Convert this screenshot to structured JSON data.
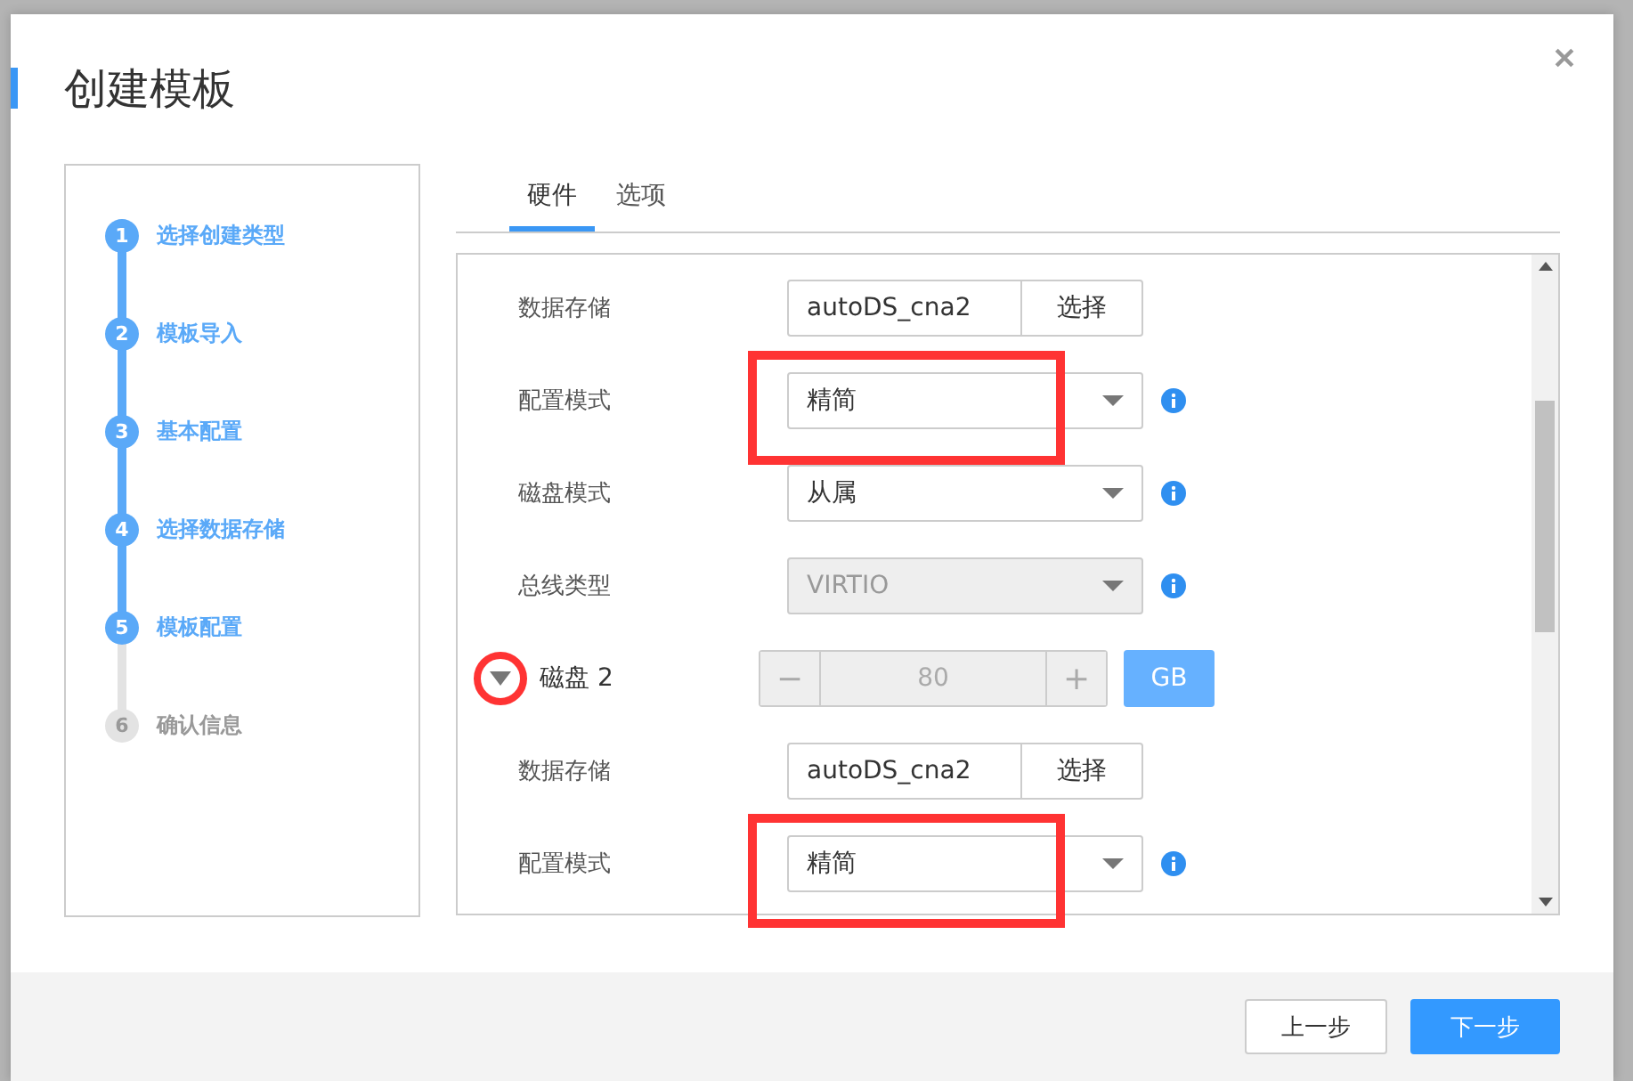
{
  "dialog": {
    "title": "创建模板"
  },
  "steps": [
    {
      "number": "1",
      "label": "选择创建类型",
      "done": true
    },
    {
      "number": "2",
      "label": "模板导入",
      "done": true
    },
    {
      "number": "3",
      "label": "基本配置",
      "done": true
    },
    {
      "number": "4",
      "label": "选择数据存储",
      "done": true
    },
    {
      "number": "5",
      "label": "模板配置",
      "done": true
    },
    {
      "number": "6",
      "label": "确认信息",
      "done": false
    }
  ],
  "tabs": [
    {
      "label": "硬件",
      "selected": true
    },
    {
      "label": "选项",
      "selected": false
    }
  ],
  "form_rows": [
    {
      "kind": "datastore",
      "label": "数据存储",
      "value": "autoDS_cna2",
      "button": "选择"
    },
    {
      "kind": "select",
      "label": "配置模式",
      "value": "精简",
      "disabled": false,
      "highlighted": true
    },
    {
      "kind": "select",
      "label": "磁盘模式",
      "value": "从属",
      "disabled": false,
      "highlighted": false
    },
    {
      "kind": "select",
      "label": "总线类型",
      "value": "VIRTIO",
      "disabled": true,
      "highlighted": false
    },
    {
      "kind": "disk",
      "label": "磁盘 2",
      "expanded": true,
      "circled": true,
      "minus": "−",
      "value": "80",
      "plus": "+",
      "unit": "GB",
      "disabled": true
    },
    {
      "kind": "datastore",
      "label": "数据存储",
      "value": "autoDS_cna2",
      "button": "选择"
    },
    {
      "kind": "select",
      "label": "配置模式",
      "value": "精简",
      "disabled": false,
      "highlighted": true
    }
  ],
  "buttons": [
    {
      "label": "上一步",
      "primary": false
    },
    {
      "label": "下一步",
      "primary": true
    }
  ]
}
